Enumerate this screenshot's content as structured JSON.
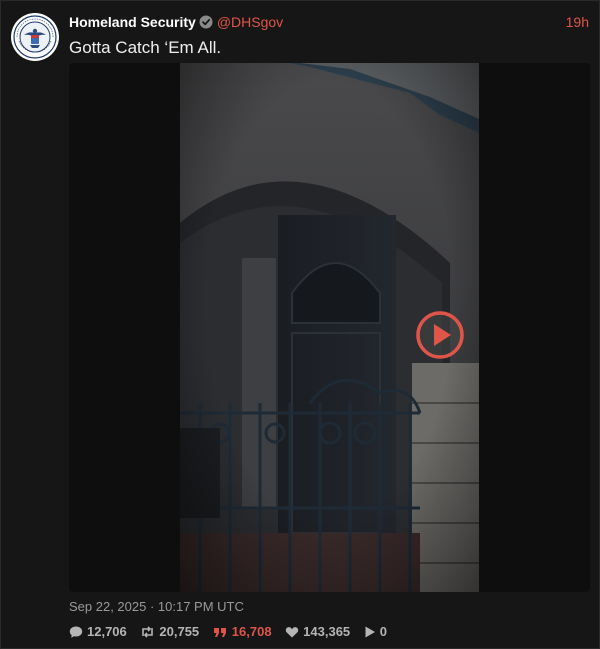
{
  "post": {
    "author": {
      "display_name": "Homeland Security",
      "handle": "@DHSgov",
      "verified": true,
      "avatar_icon": "dhs-seal-icon"
    },
    "relative_time": "19h",
    "text": "Gotta Catch ‘Em All.",
    "media": {
      "type": "video",
      "play_icon": "play-circle-icon"
    },
    "timestamp": "Sep 22, 2025 · 10:17 PM UTC",
    "stats": {
      "replies": "12,706",
      "retweets": "20,755",
      "quotes": "16,708",
      "likes": "143,365",
      "views": "0"
    }
  },
  "colors": {
    "accent": "#e0554a",
    "background": "#161616",
    "text": "#f0f0f0",
    "muted": "#9a9a9a"
  }
}
